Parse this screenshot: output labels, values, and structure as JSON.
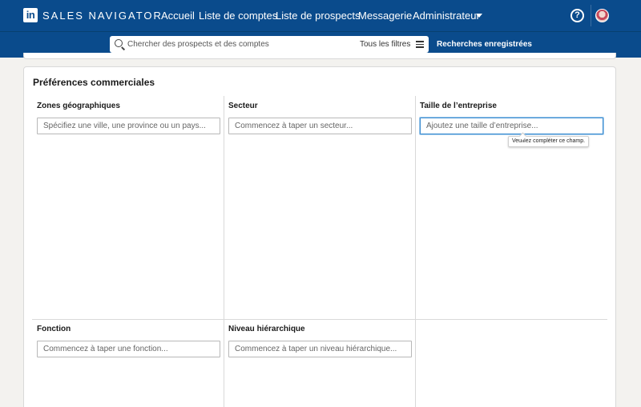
{
  "header": {
    "logo_text": "in",
    "brand": "SALES NAVIGATOR",
    "nav": [
      "Accueil",
      "Liste de comptes",
      "Liste de prospects",
      "Messagerie",
      "Administrateur"
    ]
  },
  "search": {
    "placeholder": "Chercher des prospects et des comptes",
    "filters_label": "Tous les filtres",
    "saved_searches": "Recherches enregistrées"
  },
  "preferences": {
    "title": "Préférences commerciales",
    "fields": {
      "geo": {
        "label": "Zones géographiques",
        "placeholder": "Spécifiez une ville, une province ou un pays..."
      },
      "sector": {
        "label": "Secteur",
        "placeholder": "Commencez à taper un secteur..."
      },
      "company_size": {
        "label": "Taille de l’entreprise",
        "placeholder": "Ajoutez une taille d’entreprise..."
      },
      "function": {
        "label": "Fonction",
        "placeholder": "Commencez à taper une fonction..."
      },
      "seniority": {
        "label": "Niveau hiérarchique",
        "placeholder": "Commencez à taper un niveau hiérarchique..."
      }
    },
    "tooltip": "Veuillez compléter ce champ."
  },
  "colors": {
    "nav_bg": "#0a4b8c",
    "focus": "#3b8dd1"
  },
  "icons": [
    "linkedin-logo-icon",
    "chevron-down-icon",
    "help-icon",
    "search-icon",
    "filters-icon"
  ]
}
